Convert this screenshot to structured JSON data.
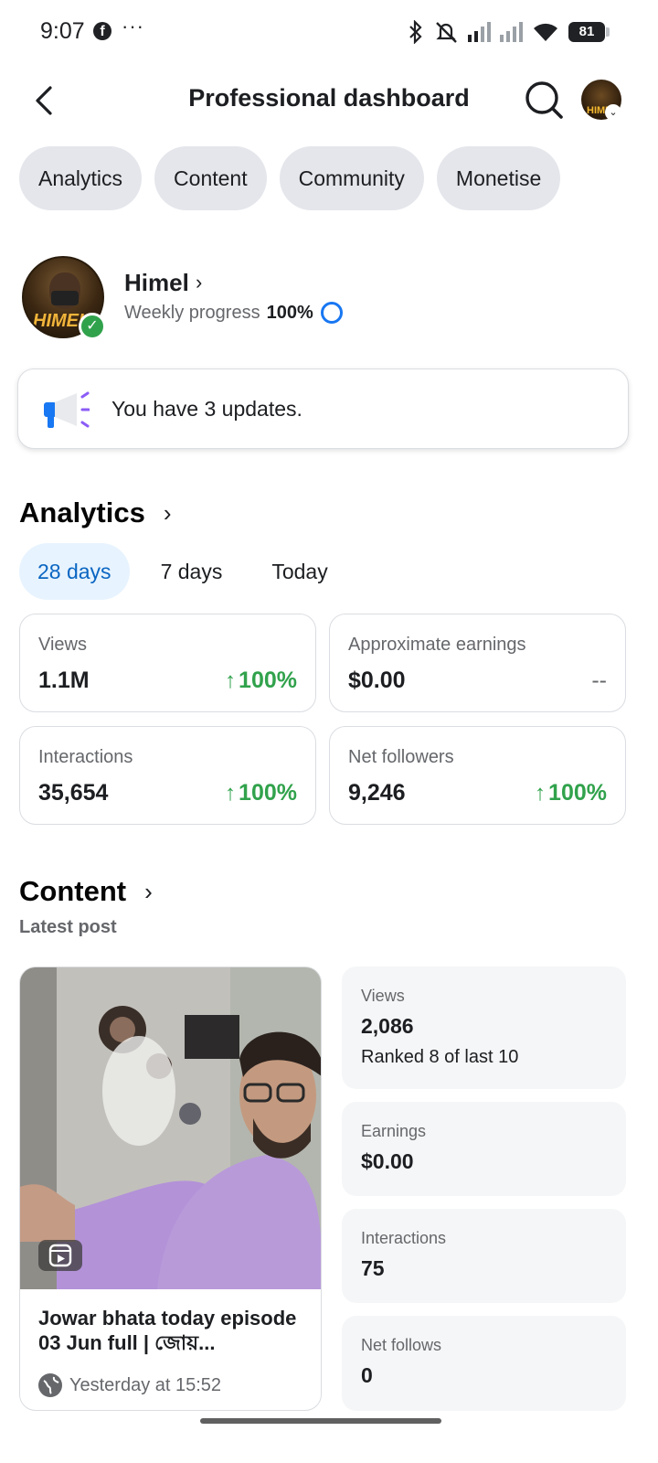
{
  "status_bar": {
    "time": "9:07",
    "battery": "81",
    "icons": [
      "facebook-icon",
      "more-dots-icon",
      "bluetooth-icon",
      "mute-icon",
      "signal-icon",
      "signal-icon",
      "wifi-icon",
      "battery-icon"
    ]
  },
  "header": {
    "title": "Professional dashboard",
    "back_icon": "chevron-left-icon",
    "search_icon": "search-icon"
  },
  "tabs": [
    {
      "label": "Analytics"
    },
    {
      "label": "Content"
    },
    {
      "label": "Community"
    },
    {
      "label": "Monetise"
    }
  ],
  "profile": {
    "name": "Himel",
    "avatar_text": "HIMEL",
    "progress_label": "Weekly progress",
    "progress_value": "100%"
  },
  "updates": {
    "text": "You have 3 updates."
  },
  "analytics": {
    "title": "Analytics",
    "periods": [
      {
        "label": "28 days",
        "active": true
      },
      {
        "label": "7 days",
        "active": false
      },
      {
        "label": "Today",
        "active": false
      }
    ],
    "metrics": [
      {
        "label": "Views",
        "value": "1.1M",
        "change": "100%"
      },
      {
        "label": "Approximate earnings",
        "value": "$0.00",
        "change": "--"
      },
      {
        "label": "Interactions",
        "value": "35,654",
        "change": "100%"
      },
      {
        "label": "Net followers",
        "value": "9,246",
        "change": "100%"
      }
    ]
  },
  "content": {
    "title": "Content",
    "subtitle": "Latest post",
    "post": {
      "title": "Jowar bhata today episode 03 Jun full | জোয়...",
      "time": "Yesterday at 15:52"
    },
    "stats": [
      {
        "label": "Views",
        "value": "2,086",
        "note": "Ranked 8 of last 10"
      },
      {
        "label": "Earnings",
        "value": "$0.00"
      },
      {
        "label": "Interactions",
        "value": "75"
      },
      {
        "label": "Net follows",
        "value": "0"
      }
    ]
  },
  "colors": {
    "accent": "#1877f2",
    "positive": "#31a24c",
    "active_tab_bg": "#e7f3ff",
    "chip_bg": "#e4e6eb"
  }
}
